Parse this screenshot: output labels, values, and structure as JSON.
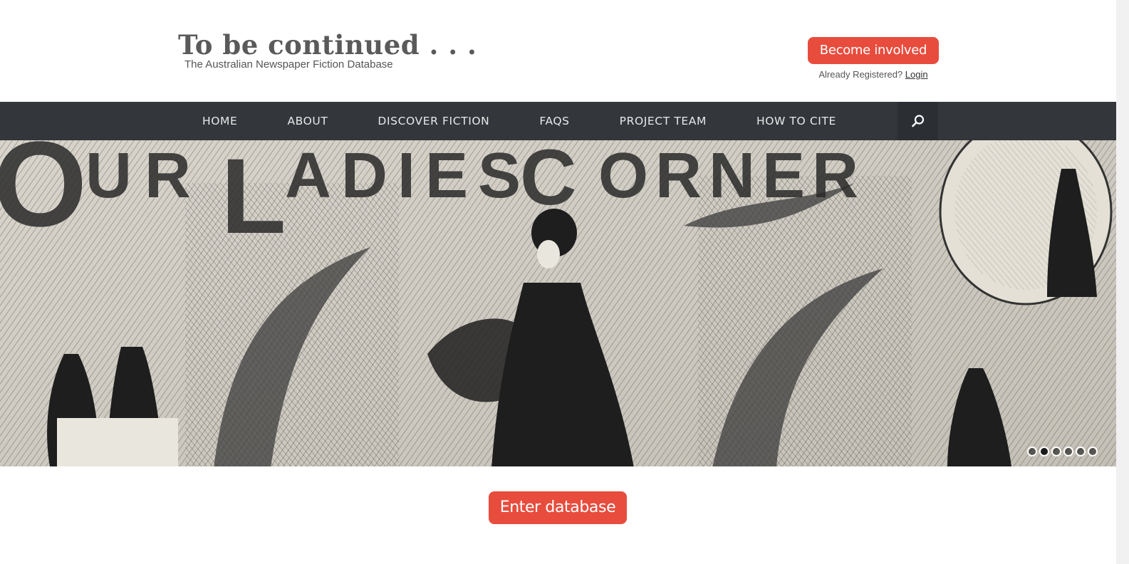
{
  "header": {
    "logo_title": "To be continued . . .",
    "logo_subtitle": "The Australian Newspaper Fiction Database",
    "cta_label": "Become involved",
    "already_text": "Already Registered?",
    "login_label": "Login"
  },
  "nav": {
    "items": [
      {
        "label": "HOME"
      },
      {
        "label": "ABOUT"
      },
      {
        "label": "DISCOVER FICTION"
      },
      {
        "label": "FAQS"
      },
      {
        "label": "PROJECT TEAM"
      },
      {
        "label": "HOW TO CITE"
      }
    ],
    "search_icon": "search-icon"
  },
  "banner": {
    "caption_art": "OUR LADIES CORNER",
    "slides": 6,
    "active_slide": 2
  },
  "main": {
    "enter_label": "Enter database"
  },
  "colors": {
    "accent": "#e84c3d",
    "nav_bg": "#33363b",
    "logo_text": "#5a5a5a"
  }
}
